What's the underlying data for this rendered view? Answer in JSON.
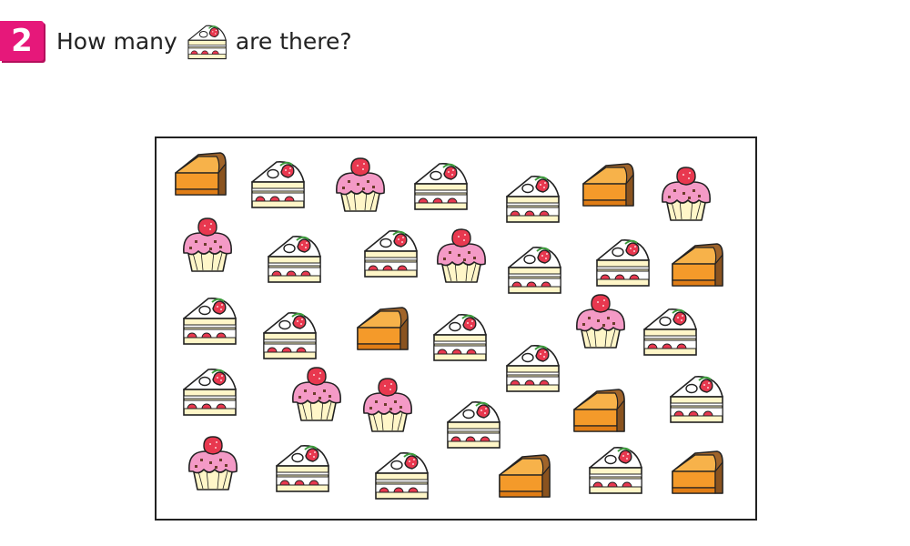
{
  "question": {
    "number": "2",
    "text_before": "How many",
    "text_after": "are there?",
    "icon": "shortcake-slice-icon"
  },
  "panel": {
    "item_types": [
      "shortcake-slice-icon",
      "cupcake-icon",
      "pumpkin-pie-slice-icon"
    ]
  },
  "colors": {
    "badge": "#e6187a",
    "strawberry": "#e8384f",
    "cupcake_frosting": "#f49ac6",
    "pie_filling": "#f49a2a",
    "pie_crust": "#a0642a",
    "cream": "#ffffff",
    "sponge": "#fff6c8"
  }
}
